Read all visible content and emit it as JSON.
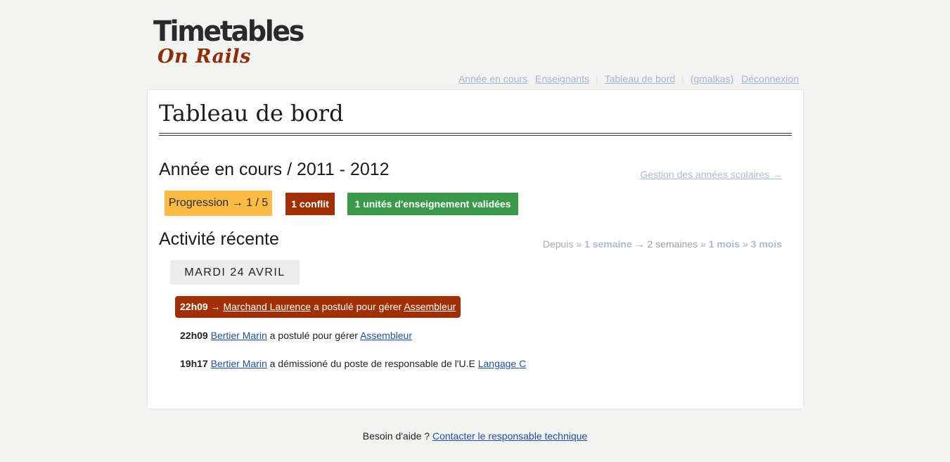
{
  "brand": {
    "title": "Timetables",
    "subtitle": "On Rails"
  },
  "nav": {
    "current_year": "Année en cours",
    "teachers": "Enseignants",
    "dashboard": "Tableau de bord",
    "user": "(gmalkas)",
    "logout": "Déconnexion"
  },
  "page": {
    "title": "Tableau de bord"
  },
  "year": {
    "heading": "Année en cours / 2011 - 2012",
    "manage_link": "Gestion des années scolaires →",
    "progress": "Progression → 1 / 5",
    "conflicts": "1 conflit",
    "validated": "1 unités d'enseignement validées"
  },
  "activity": {
    "heading": "Activité récente",
    "filter": {
      "since": "Depuis",
      "sep1": "»",
      "one_week": "1 semaine",
      "arrow": "→",
      "two_weeks": "2 semaines",
      "sep2": "»",
      "one_month": "1 mois",
      "sep3": "»",
      "three_months": "3 mois"
    },
    "day": "MARDI 24 AVRIL",
    "entries": [
      {
        "time": "22h09",
        "arrow": "→",
        "person": "Marchand Laurence",
        "action": "a postulé pour gérer",
        "target": "Assembleur",
        "highlighted": true
      },
      {
        "time": "22h09",
        "person": "Bertier Marin",
        "action": "a postulé pour gérer",
        "target": "Assembleur",
        "highlighted": false
      },
      {
        "time": "19h17",
        "person": "Bertier Marin",
        "action": "a démissioné du poste de responsable de l'U.E",
        "target": "Langage C",
        "highlighted": false
      }
    ]
  },
  "footer": {
    "question": "Besoin d'aide ?",
    "contact": "Contacter le responsable technique"
  },
  "colors": {
    "brand_red": "#a13006",
    "progress_yellow": "#fcbc44",
    "validated_green": "#3a9a4a",
    "link_blue": "#1f4e9a"
  }
}
